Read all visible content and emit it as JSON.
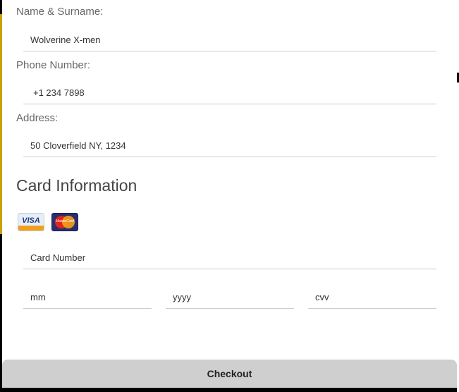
{
  "form": {
    "name_label": "Name & Surname:",
    "name_value": "Wolverine X-men",
    "phone_label": "Phone Number:",
    "phone_value": "+1 234 7898",
    "address_label": "Address:",
    "address_value": "50 Cloverfield NY, 1234"
  },
  "card": {
    "title": "Card Information",
    "visa_text": "VISA",
    "mastercard_text": "MasterCard",
    "number_placeholder": "Card Number",
    "month_placeholder": "mm",
    "year_placeholder": "yyyy",
    "cvv_placeholder": "cvv"
  },
  "checkout_label": "Checkout",
  "colors": {
    "accent_bar": "#c9a100",
    "checkout_bg": "#cfcfcf"
  }
}
